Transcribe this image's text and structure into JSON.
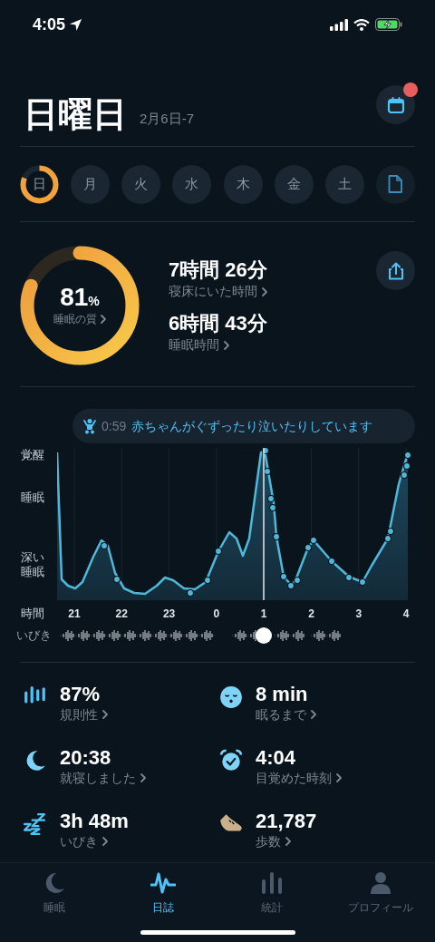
{
  "status_bar": {
    "time": "4:05"
  },
  "header": {
    "title": "日曜日",
    "date": "2月6日-7",
    "calendar_badge": true
  },
  "days": [
    {
      "label": "日",
      "selected": true
    },
    {
      "label": "月",
      "selected": false
    },
    {
      "label": "火",
      "selected": false
    },
    {
      "label": "水",
      "selected": false
    },
    {
      "label": "木",
      "selected": false
    },
    {
      "label": "金",
      "selected": false
    },
    {
      "label": "土",
      "selected": false
    }
  ],
  "summary": {
    "quality": {
      "value": "81",
      "unit": "%",
      "label": "睡眠の質"
    },
    "stats": [
      {
        "value": "7時間 26分",
        "label": "寝床にいた時間"
      },
      {
        "value": "6時間 43分",
        "label": "睡眠時間"
      }
    ]
  },
  "event": {
    "time": "0:59",
    "text": "赤ちゃんがぐずったり泣いたりしています"
  },
  "graph": {
    "y_labels": [
      "覚醒",
      "睡眠",
      "深い睡眠"
    ],
    "x_label": "時間",
    "hours": [
      "21",
      "22",
      "23",
      "0",
      "1",
      "2",
      "3",
      "4"
    ],
    "snore_label": "いびき"
  },
  "metrics": [
    {
      "kind": "regularity",
      "value": "87%",
      "label": "規則性"
    },
    {
      "kind": "fall_asleep",
      "value": "8 min",
      "label": "眠るまで"
    },
    {
      "kind": "bedtime",
      "value": "20:38",
      "label": "就寝しました"
    },
    {
      "kind": "wake",
      "value": "4:04",
      "label": "目覚めた時刻"
    },
    {
      "kind": "snore",
      "value": "3h 48m",
      "label": "いびき"
    },
    {
      "kind": "steps",
      "value": "21,787",
      "label": "歩数"
    }
  ],
  "tabs": [
    {
      "kind": "sleep",
      "label": "睡眠",
      "selected": false
    },
    {
      "kind": "journal",
      "label": "日誌",
      "selected": true
    },
    {
      "kind": "stats",
      "label": "統計",
      "selected": false
    },
    {
      "kind": "profile",
      "label": "プロフィール",
      "selected": false
    }
  ]
}
